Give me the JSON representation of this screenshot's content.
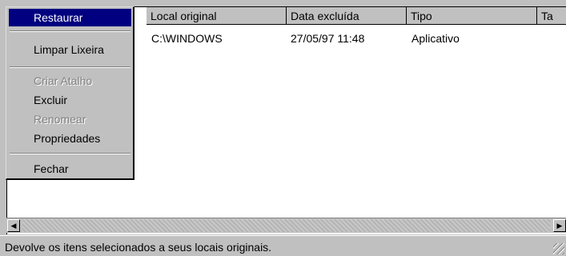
{
  "columns": [
    "Local original",
    "Data excluída",
    "Tipo",
    "Ta"
  ],
  "row": {
    "local": "C:\\WINDOWS",
    "data": "27/05/97 11:48",
    "tipo": "Aplicativo"
  },
  "menu": [
    {
      "label": "Restaurar",
      "state": "selected"
    },
    {
      "label": "Limpar Lixeira",
      "state": "normal"
    },
    {
      "label": "Criar Atalho",
      "state": "disabled"
    },
    {
      "label": "Excluir",
      "state": "normal"
    },
    {
      "label": "Renomear",
      "state": "disabled"
    },
    {
      "label": "Propriedades",
      "state": "normal"
    },
    {
      "label": "Fechar",
      "state": "normal"
    }
  ],
  "status": "Devolve os itens selecionados a seus locais originais.",
  "icons": {
    "scroll_left": "arrow-left-icon",
    "scroll_right": "arrow-right-icon",
    "size_grip": "resize-grip-icon"
  }
}
